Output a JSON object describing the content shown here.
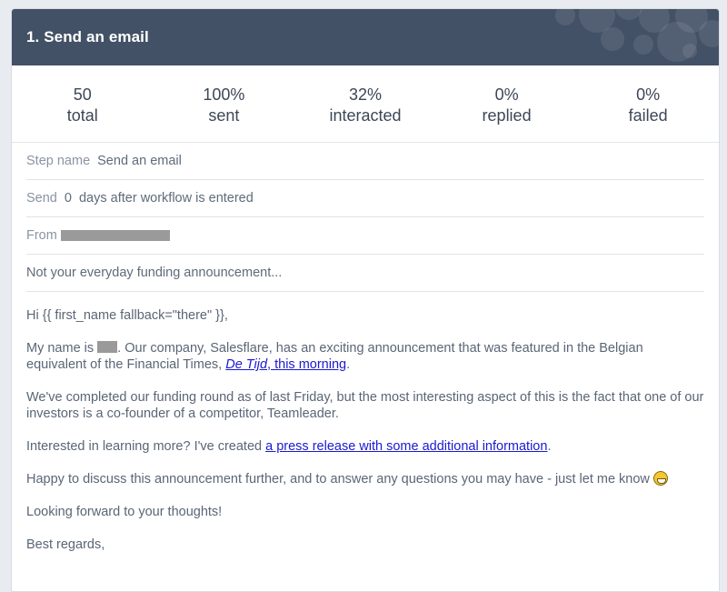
{
  "header": {
    "title": "1. Send an email"
  },
  "stats": [
    {
      "value": "50",
      "label": "total"
    },
    {
      "value": "100%",
      "label": "sent"
    },
    {
      "value": "32%",
      "label": "interacted"
    },
    {
      "value": "0%",
      "label": "replied"
    },
    {
      "value": "0%",
      "label": "failed"
    }
  ],
  "fields": {
    "step_name_label": "Step name",
    "step_name_value": "Send an email",
    "send_label": "Send",
    "send_value": "0  days after workflow is entered",
    "from_label": "From",
    "subject": "Not your everyday funding announcement..."
  },
  "email": {
    "greeting": "Hi {{ first_name fallback=\"there\" }},",
    "p1_a": "My name is ",
    "p1_b": ". Our company, Salesflare, has an exciting announcement that was featured in the Belgian equivalent of the Financial Times, ",
    "p1_link_italic": "De Tijd",
    "p1_link_rest": ", this morning",
    "p1_end": ".",
    "p2": "We've completed our funding round as of last Friday, but the most interesting aspect of this is the fact that one of our investors is a co-founder of a competitor, Teamleader.",
    "p3_a": "Interested in learning more? I've created ",
    "p3_link": "a press release with some additional information",
    "p3_end": ".",
    "p4": "Happy to discuss this announcement further, and to answer any questions you may have - just let me know ",
    "p5": "Looking forward to your thoughts!",
    "signoff": "Best regards,"
  }
}
